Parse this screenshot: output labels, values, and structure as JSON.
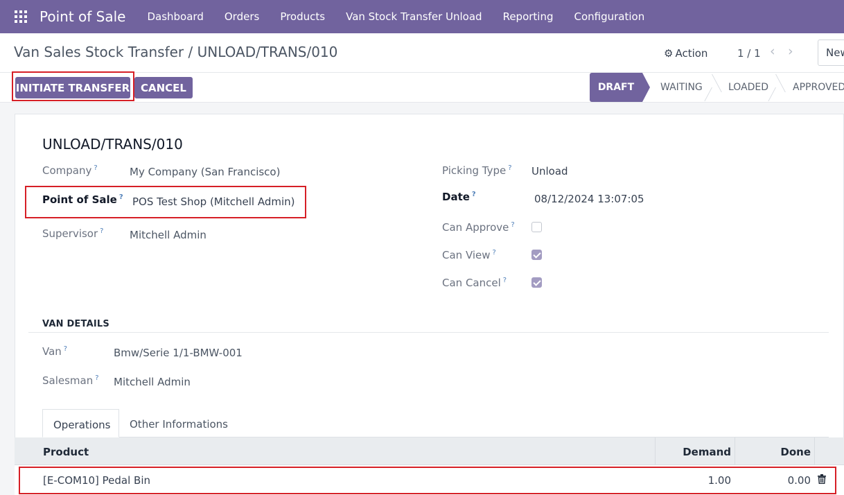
{
  "navbar": {
    "brand": "Point of Sale",
    "menu": [
      "Dashboard",
      "Orders",
      "Products",
      "Van Stock Transfer Unload",
      "Reporting",
      "Configuration"
    ]
  },
  "control": {
    "breadcrumb": "Van Sales Stock Transfer / UNLOAD/TRANS/010",
    "action_label": "Action",
    "pager": "1 / 1",
    "new_label": "New"
  },
  "buttons": {
    "initiate": "INITIATE TRANSFER",
    "cancel": "CANCEL"
  },
  "stages": [
    "DRAFT",
    "WAITING",
    "LOADED",
    "APPROVED"
  ],
  "active_stage": "DRAFT",
  "form": {
    "title": "UNLOAD/TRANS/010",
    "company_label": "Company",
    "company_value": "My Company (San Francisco)",
    "pos_label": "Point of Sale",
    "pos_value": "POS Test Shop (Mitchell Admin)",
    "supervisor_label": "Supervisor",
    "supervisor_value": "Mitchell Admin",
    "picking_type_label": "Picking Type",
    "picking_type_value": "Unload",
    "date_label": "Date",
    "date_value": "08/12/2024 13:07:05",
    "can_approve_label": "Can Approve",
    "can_approve": false,
    "can_view_label": "Can View",
    "can_view": true,
    "can_cancel_label": "Can Cancel",
    "can_cancel": true,
    "help_mark": "?"
  },
  "van": {
    "section_title": "VAN DETAILS",
    "van_label": "Van",
    "van_value": "Bmw/Serie 1/1-BMW-001",
    "salesman_label": "Salesman",
    "salesman_value": "Mitchell Admin"
  },
  "tabs": [
    "Operations",
    "Other Informations"
  ],
  "table": {
    "headers": {
      "product": "Product",
      "demand": "Demand",
      "done": "Done"
    },
    "rows": [
      {
        "product": "[E-COM10] Pedal Bin",
        "demand": "1.00",
        "done": "0.00"
      }
    ]
  },
  "colors": {
    "brand": "#71639e",
    "highlight": "#d61f26"
  }
}
